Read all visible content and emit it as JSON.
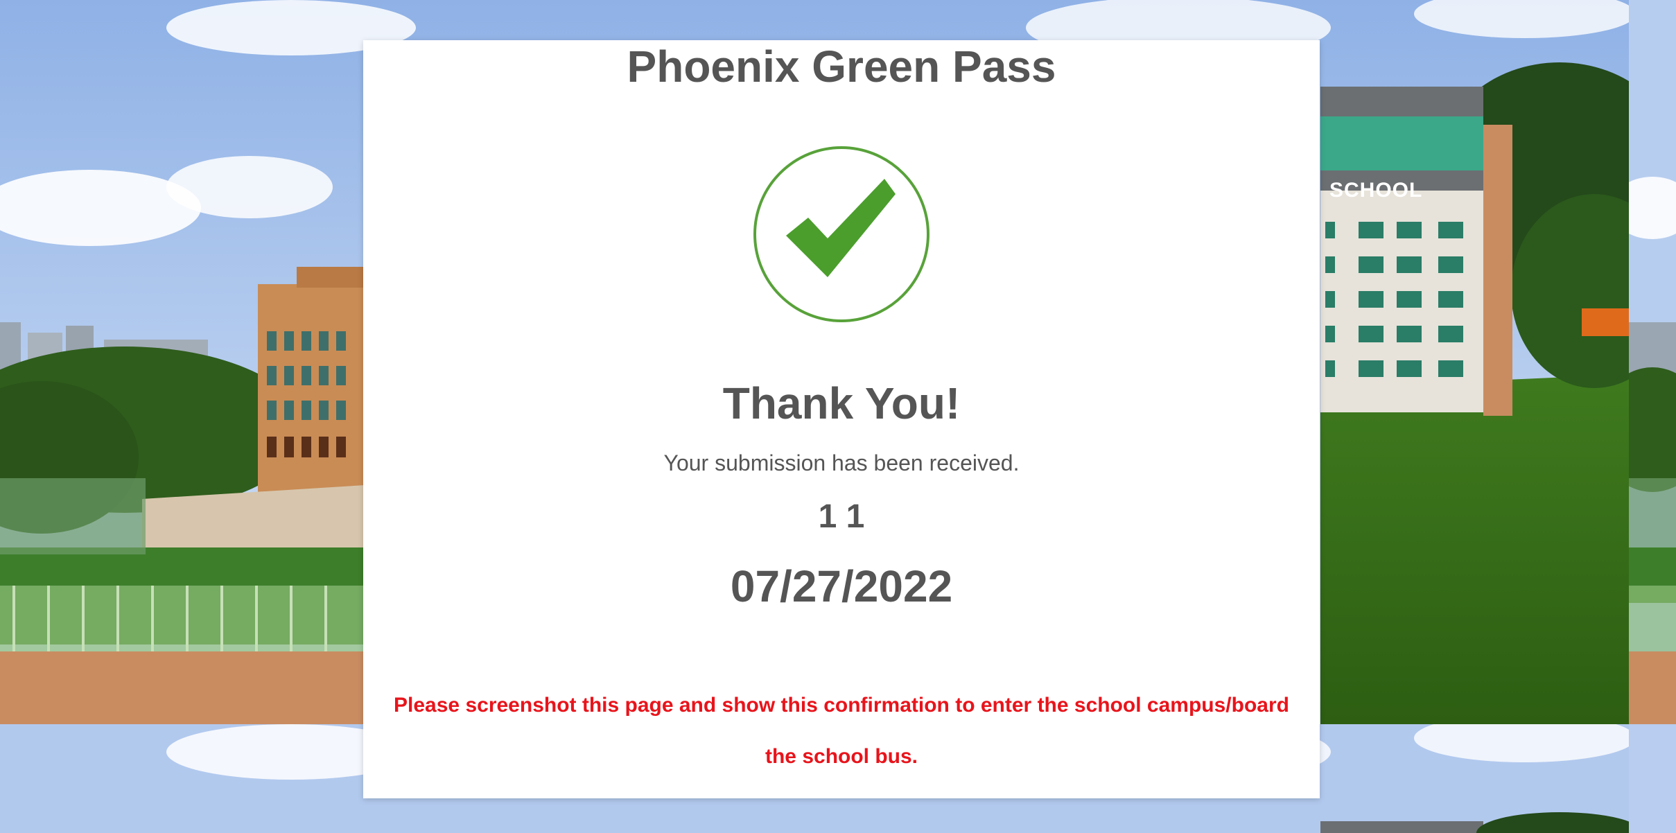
{
  "page": {
    "title": "Phoenix Green Pass",
    "heading": "Thank You!",
    "message": "Your submission has been received.",
    "identifier": "1 1",
    "date": "07/27/2022",
    "notice": "Please screenshot this page and show this confirmation to enter the school campus/board the school bus."
  },
  "background": {
    "school_sign": "SCHOOL"
  },
  "icons": {
    "confirmation": "checkmark-icon"
  },
  "colors": {
    "text": "#555555",
    "check_green": "#4b9e2c",
    "notice_red": "#e8141b",
    "card": "#ffffff"
  }
}
